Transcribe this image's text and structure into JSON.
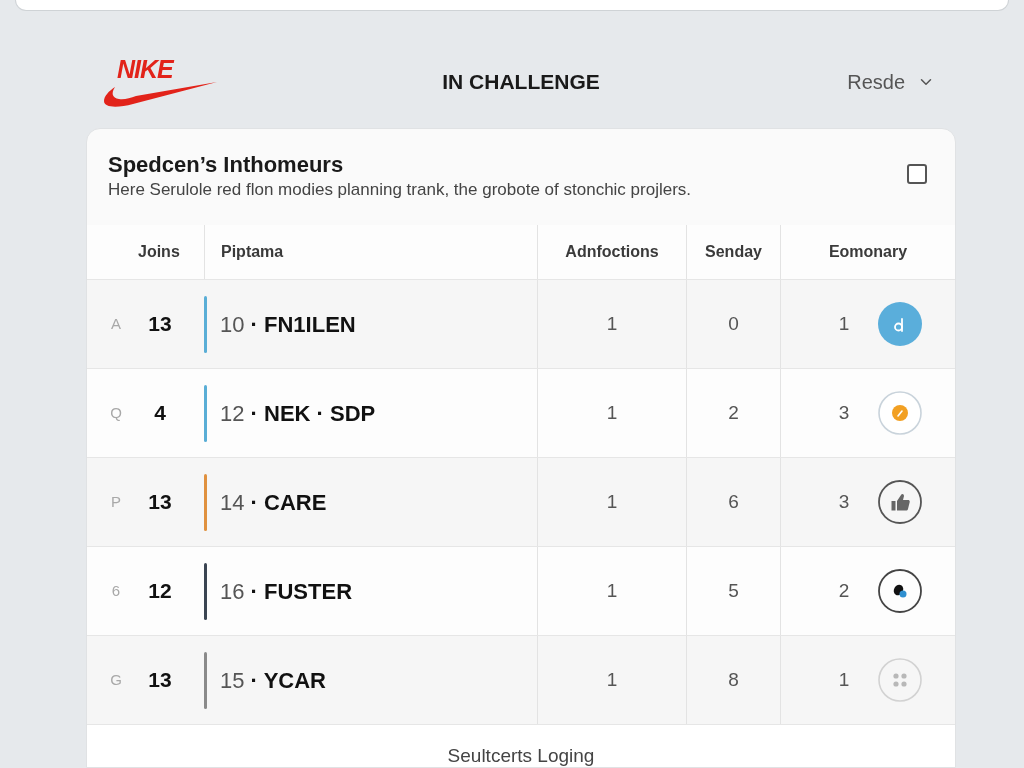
{
  "header": {
    "logo": "NIKE",
    "title": "IN CHALLENGE",
    "dropdown": "Resde"
  },
  "card": {
    "title": "Spedcen’s Inthomeurs",
    "subtitle": "Here Serulole red flon modies planning trank, the grobote of stonchic projlers.",
    "checked": false
  },
  "table": {
    "columns": [
      "Joins",
      "Piptama",
      "Adnfoctions",
      "Senday",
      "Eomonary"
    ],
    "rows": [
      {
        "marker": "A",
        "joins": "13",
        "label": "10 **· FN1ILEN**",
        "color": "#5aaed6",
        "adnfoctions": "1",
        "senday": "0",
        "eomonary": "1"
      },
      {
        "marker": "Q",
        "joins": "4",
        "label": "12 **· NEK · SDP**",
        "color": "#5aaed6",
        "adnfoctions": "1",
        "senday": "2",
        "eomonary": "3"
      },
      {
        "marker": "P",
        "joins": "13",
        "label": "14 **· CARE**",
        "color": "#e0913f",
        "adnfoctions": "1",
        "senday": "6",
        "eomonary": "3"
      },
      {
        "marker": "6",
        "joins": "12",
        "label": "16 **· FUSTER**",
        "color": "#3b4552",
        "adnfoctions": "1",
        "senday": "5",
        "eomonary": "2"
      },
      {
        "marker": "G",
        "joins": "13",
        "label": "15 **· YCAR**",
        "color": "#8a8a8a",
        "adnfoctions": "1",
        "senday": "8",
        "eomonary": "1"
      }
    ]
  },
  "footer": "Seultcerts Loging"
}
